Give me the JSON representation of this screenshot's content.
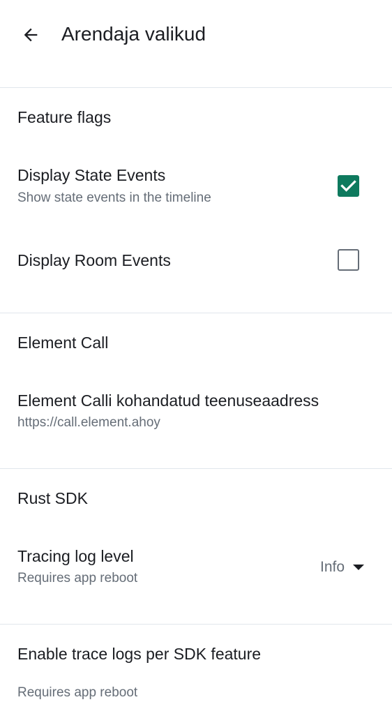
{
  "header": {
    "title": "Arendaja valikud",
    "back_icon": "arrow-back-icon"
  },
  "sections": {
    "feature_flags": {
      "title": "Feature flags",
      "items": [
        {
          "title": "Display State Events",
          "subtitle": "Show state events in the timeline",
          "checked": true
        },
        {
          "title": "Display Room Events",
          "checked": false
        }
      ]
    },
    "element_call": {
      "title": "Element Call",
      "item": {
        "title": "Element Calli kohandatud teenuseaadress",
        "subtitle": "https://call.element.ahoy"
      }
    },
    "rust_sdk": {
      "title": "Rust SDK",
      "item": {
        "title": "Tracing log level",
        "subtitle": "Requires app reboot",
        "value": "Info"
      }
    },
    "trace_logs": {
      "title": "Enable trace logs per SDK feature",
      "subtitle": "Requires app reboot"
    }
  },
  "colors": {
    "accent": "#0e7a5e",
    "text_primary": "#1b1d22",
    "text_secondary": "#656d77",
    "divider": "#e1e6ec"
  }
}
